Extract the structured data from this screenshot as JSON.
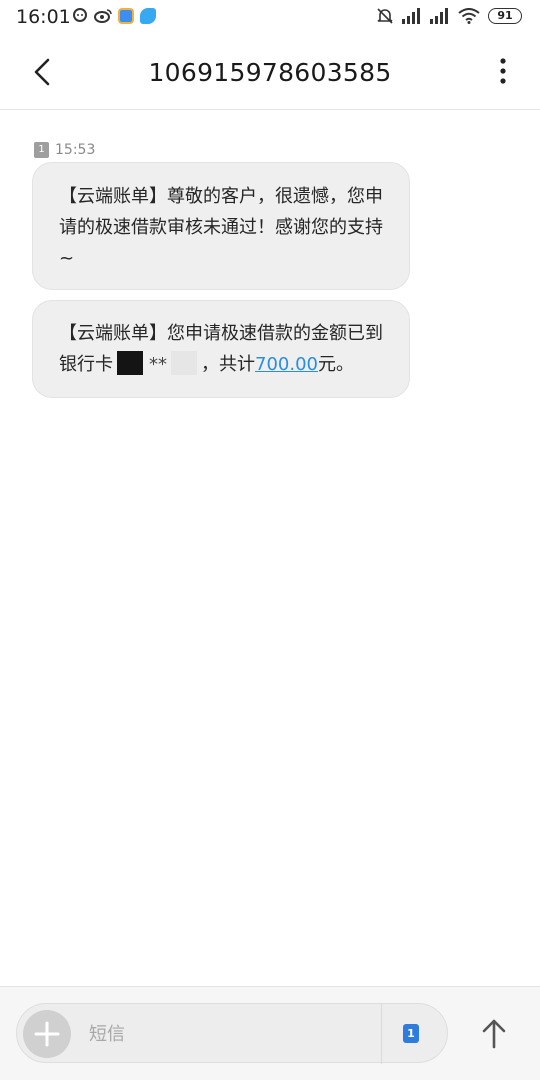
{
  "status_bar": {
    "time": "16:01",
    "battery": "91",
    "icons": [
      "chat-app-icon",
      "weibo-icon",
      "calendar-app-icon",
      "blue-app-icon",
      "mute-icon",
      "signal-icon",
      "signal-icon",
      "wifi-icon",
      "battery-icon"
    ]
  },
  "header": {
    "title": "106915978603585"
  },
  "conversation": {
    "sim_number": "1",
    "time": "15:53",
    "messages": [
      {
        "text": "【云端账单】尊敬的客户，很遗憾，您申请的极速借款审核未通过！感谢您的支持~"
      },
      {
        "text_before": "【云端账单】您申请极速借款的金额已到银行卡",
        "masked": "**",
        "text_mid": "，共计",
        "amount": "700.00",
        "text_after": "元。"
      }
    ]
  },
  "composer": {
    "placeholder": "短信",
    "sim_number": "1"
  },
  "colors": {
    "link": "#2a8ee0",
    "sim_accent": "#2f7bde",
    "bubble": "#efefef"
  }
}
